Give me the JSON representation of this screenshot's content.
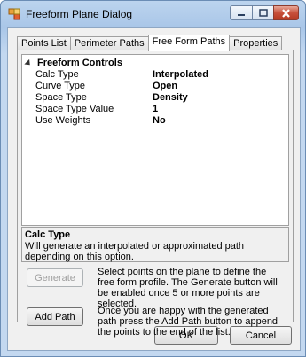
{
  "window": {
    "title": "Freeform Plane Dialog"
  },
  "tabs": [
    {
      "label": "Points List"
    },
    {
      "label": "Perimeter Paths"
    },
    {
      "label": "Free Form Paths"
    },
    {
      "label": "Properties"
    }
  ],
  "grid": {
    "category": "Freeform Controls",
    "rows": [
      {
        "key": "Calc Type",
        "value": "Interpolated"
      },
      {
        "key": "Curve Type",
        "value": "Open"
      },
      {
        "key": "Space Type",
        "value": "Density"
      },
      {
        "key": "Space Type Value",
        "value": "1"
      },
      {
        "key": "Use Weights",
        "value": "No"
      }
    ]
  },
  "help": {
    "title": "Calc Type",
    "description": "Will generate an interpolated or approximated path depending on this option."
  },
  "actions": {
    "generate_label": "Generate",
    "generate_desc": "Select points on the plane to define the free form profile.  The Generate button will be enabled once 5 or more points are selected.",
    "add_path_label": "Add Path",
    "add_path_desc": "Once you are happy with the generated path press the Add Path button to append the points to the end of the list."
  },
  "footer": {
    "ok_label": "OK",
    "cancel_label": "Cancel"
  }
}
